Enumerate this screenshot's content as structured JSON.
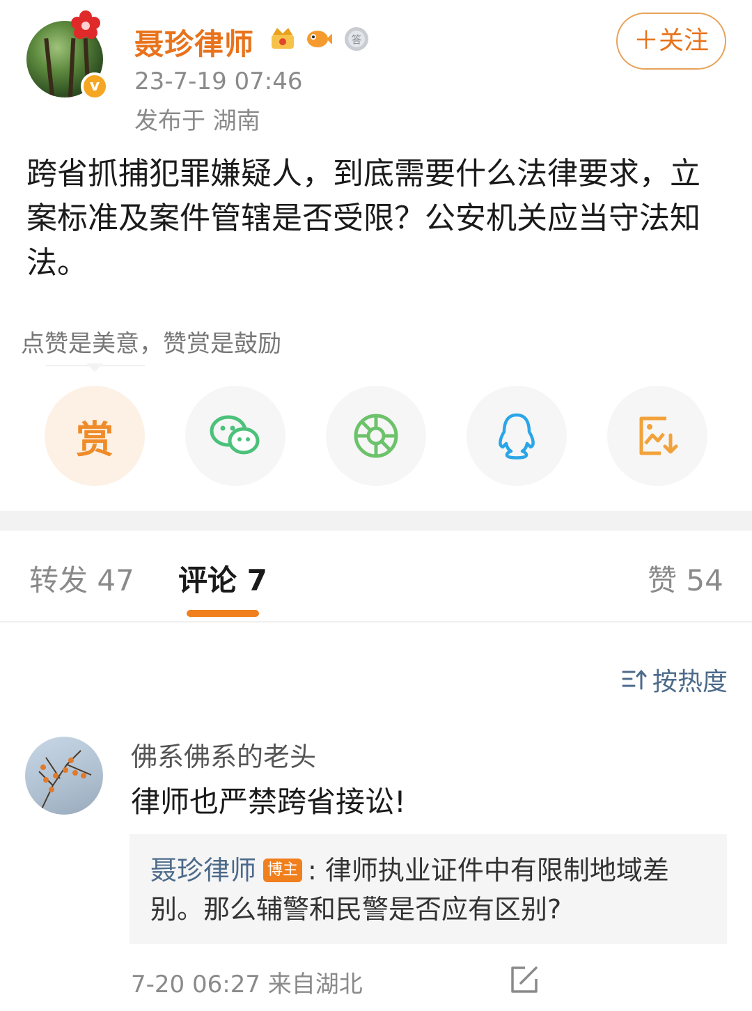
{
  "post": {
    "author": "聂珍律师",
    "timestamp": "23-7-19 07:46",
    "location": "发布于 湖南",
    "follow_label": "＋关注",
    "text": "跨省抓捕犯罪嫌疑人，到底需要什么法律要求，立案标准及案件管辖是否受限？公安机关应当守法知法。",
    "badges": [
      "crown-badge-icon",
      "fish-badge-icon",
      "medal-badge-icon"
    ]
  },
  "reward": {
    "hint": "点赞是美意，赞赏是鼓励",
    "reward_label": "赏"
  },
  "share_icons": [
    "reward-icon",
    "wechat-icon",
    "moments-icon",
    "qq-icon",
    "save-image-icon"
  ],
  "tabs": [
    {
      "label": "转发 47"
    },
    {
      "label": "评论 7"
    },
    {
      "label": "赞 54"
    }
  ],
  "sort_label": "按热度",
  "comment": {
    "user": "佛系佛系的老头",
    "text": "律师也严禁跨省接讼!",
    "reply": {
      "author": "聂珍律师",
      "tag": "博主",
      "text": ": 律师执业证件中有限制地域差别。那么辅警和民警是否应有区别?"
    },
    "meta": "7-20 06:27  来自湖北"
  },
  "colors": {
    "accent": "#e8731c",
    "link": "#4c6a8a",
    "wechat": "#4cc17a",
    "qq": "#2aa6e8",
    "save": "#f2a23a"
  }
}
